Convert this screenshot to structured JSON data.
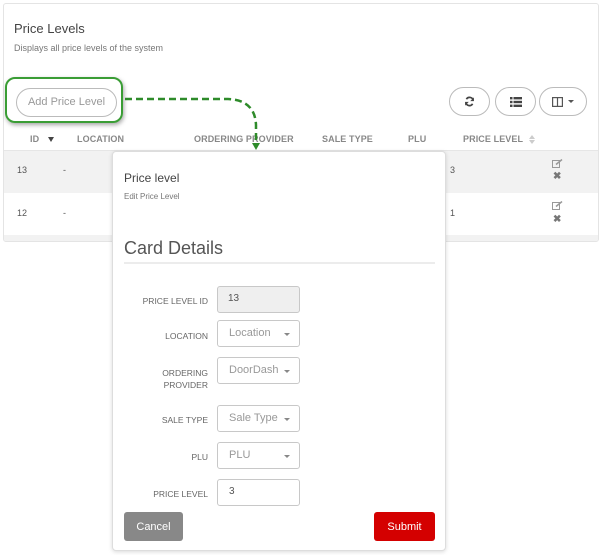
{
  "page": {
    "title": "Price Levels",
    "subtitle": "Displays all price levels of the system",
    "add_button_label": "Add Price Level"
  },
  "toolbar": {
    "refresh_icon": "refresh-icon",
    "list_icon": "list-icon",
    "columns_icon": "columns-icon"
  },
  "table": {
    "columns": [
      {
        "label": "ID",
        "sort": "desc"
      },
      {
        "label": "LOCATION"
      },
      {
        "label": "ORDERING PROVIDER"
      },
      {
        "label": "SALE TYPE"
      },
      {
        "label": "PLU"
      },
      {
        "label": "PRICE LEVEL",
        "sort": "none"
      }
    ],
    "rows": [
      {
        "id": "13",
        "location": "-",
        "price_level": "3"
      },
      {
        "id": "12",
        "location": "-",
        "price_level": "1"
      }
    ],
    "row_actions": {
      "edit_icon": "edit-icon",
      "delete_icon": "delete-icon",
      "delete_glyph": "✖"
    }
  },
  "modal": {
    "title": "Price level",
    "subtitle": "Edit Price Level",
    "section_title": "Card Details",
    "fields": {
      "price_level_id": {
        "label": "PRICE LEVEL ID",
        "value": "13"
      },
      "location": {
        "label": "LOCATION",
        "value": "Location"
      },
      "ordering_provider": {
        "label_line1": "ORDERING",
        "label_line2": "PROVIDER",
        "value": "DoorDash"
      },
      "sale_type": {
        "label": "SALE TYPE",
        "value": "Sale Type"
      },
      "plu": {
        "label": "PLU",
        "value": "PLU"
      },
      "price_level": {
        "label": "PRICE LEVEL",
        "value": "3"
      }
    },
    "cancel_label": "Cancel",
    "submit_label": "Submit"
  },
  "colors": {
    "highlight": "#3a9d35",
    "connector": "#2e8b2a",
    "submit": "#d40000",
    "cancel": "#888888"
  }
}
